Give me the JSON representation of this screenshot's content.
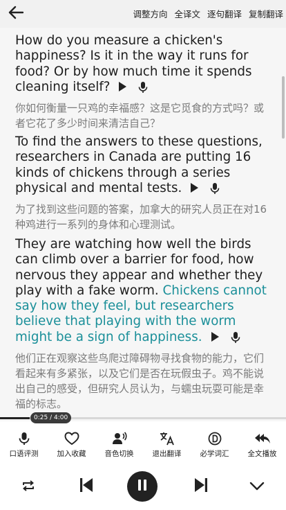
{
  "topbar": {
    "back_icon": "arrow-left-icon",
    "actions": [
      "调整方向",
      "全译文",
      "逐句翻译",
      "复制翻译"
    ]
  },
  "paragraphs": [
    {
      "en": "How do you measure a chicken's happiness? Is it in the way it runs for food? Or by how much time it spends cleaning itself?",
      "en_highlight": "",
      "zh": "你如何衡量一只鸡的幸福感？这是它觅食的方式吗？或者它花了多少时间来清洁自己？"
    },
    {
      "en": "To find the answers to these questions, researchers in Canada are putting 16 kinds of chickens through a series physical and mental tests.",
      "en_highlight": "",
      "zh": "为了找到这些问题的答案，加拿大的研究人员正在对16种鸡进行一系列的身体和心理测试。"
    },
    {
      "en": "They are watching how well the birds can climb over a barrier for food, how nervous they appear and whether they play with a fake worm.",
      "en_highlight": "Chickens cannot say how they feel, but researchers believe that playing with the worm might be a sign of happiness.",
      "zh": "他们正在观察这些鸟爬过障碍物寻找食物的能力，它们看起来有多紧张，以及它们是否在玩假虫子。鸡不能说出自己的感受，但研究人员认为，与蠕虫玩耍可能是幸福的标志。"
    }
  ],
  "progress": {
    "time": "0:25 / 4:00",
    "fraction": 0.104
  },
  "functions": [
    {
      "label": "口语评测",
      "icon": "microphone-icon"
    },
    {
      "label": "加入收藏",
      "icon": "heart-icon"
    },
    {
      "label": "音色切换",
      "icon": "voice-switch-icon"
    },
    {
      "label": "退出翻译",
      "icon": "translate-icon"
    },
    {
      "label": "必学词汇",
      "icon": "vocabulary-icon"
    },
    {
      "label": "全文播放",
      "icon": "reply-all-icon"
    }
  ],
  "player": {
    "repeat_icon": "repeat-icon",
    "prev_icon": "skip-previous-icon",
    "pause_icon": "pause-icon",
    "next_icon": "skip-next-icon",
    "collapse_icon": "chevron-down-icon"
  },
  "colors": {
    "highlight": "#1a8f99",
    "background": "#f6f6f6",
    "topbar": "#f1f1f1"
  }
}
